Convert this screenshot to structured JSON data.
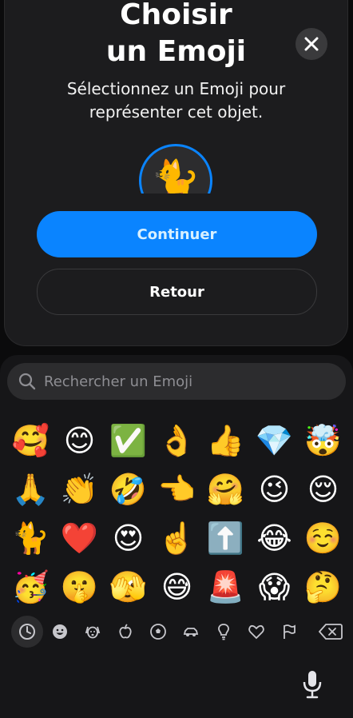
{
  "modal": {
    "title_line1": "Choisir",
    "title_line2": "un Emoji",
    "subtitle_line1": "Sélectionnez un Emoji pour",
    "subtitle_line2": "représenter cet objet.",
    "selected_emoji": "🐈",
    "continue_label": "Continuer",
    "back_label": "Retour",
    "accent_color": "#0a84ff"
  },
  "keyboard": {
    "search_placeholder": "Rechercher un Emoji",
    "emojis": [
      "🥰",
      "😊",
      "✅",
      "👌",
      "👍",
      "💎",
      "🤯",
      "🙏",
      "👏",
      "🤣",
      "👈",
      "🤗",
      "😉",
      "😌",
      "🐈",
      "❤️",
      "😍",
      "☝️",
      "⬆️",
      "😂",
      "☺️",
      "🥳",
      "🤫",
      "🫣",
      "😅",
      "🚨",
      "😱",
      "🤔"
    ],
    "categories": [
      {
        "icon": "clock-icon",
        "active": true
      },
      {
        "icon": "smiley-icon",
        "active": false
      },
      {
        "icon": "dog-icon",
        "active": false
      },
      {
        "icon": "apple-icon",
        "active": false
      },
      {
        "icon": "soccer-ball-icon",
        "active": false
      },
      {
        "icon": "car-icon",
        "active": false
      },
      {
        "icon": "lightbulb-icon",
        "active": false
      },
      {
        "icon": "heart-icon",
        "active": false
      },
      {
        "icon": "flag-icon",
        "active": false
      }
    ]
  }
}
